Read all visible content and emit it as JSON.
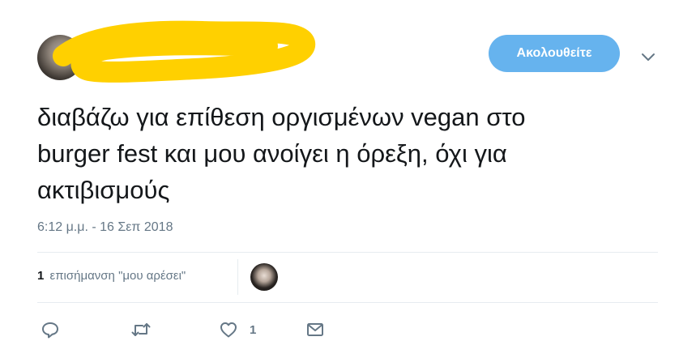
{
  "header": {
    "follow_label": "Ακολουθείτε",
    "icons": {
      "menu": "chevron-down-icon"
    }
  },
  "tweet": {
    "text": "διαβάζω για επίθεση οργισμένων vegan στο\nburger fest και μου ανοίγει η όρεξη, όχι για\nακτιβισμούς",
    "timestamp": "6:12 μ.μ. - 16 Σεπ 2018"
  },
  "stats": {
    "likes_count": "1",
    "likes_label": "επισήμανση \"μου αρέσει\""
  },
  "actions": {
    "reply_icon": "reply-icon",
    "retweet_icon": "retweet-icon",
    "like_icon": "heart-icon",
    "like_count": "1",
    "dm_icon": "envelope-icon"
  },
  "colors": {
    "follow_button": "#66b3ee",
    "text_primary": "#14171a",
    "text_secondary": "#657786",
    "divider": "#e6ecf0",
    "redaction": "#ffd000"
  }
}
